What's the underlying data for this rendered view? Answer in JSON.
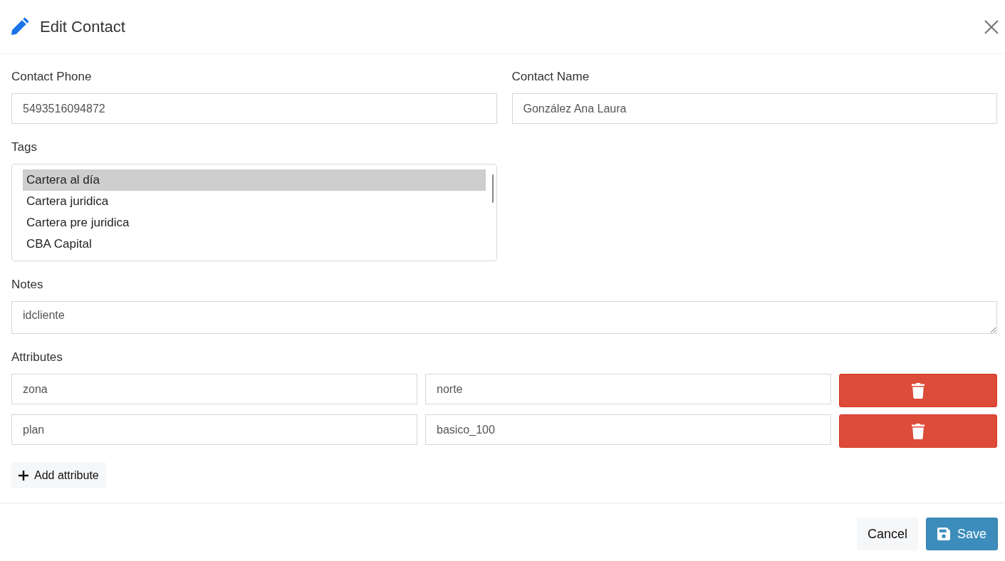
{
  "dialog": {
    "title": "Edit Contact"
  },
  "fields": [
    {
      "label": "Contact Phone",
      "value": "5493516094872"
    },
    {
      "label": "Contact Name",
      "value": "González Ana Laura"
    }
  ],
  "tags": {
    "label": "Tags",
    "options": [
      {
        "label": "Cartera al día",
        "selected": true
      },
      {
        "label": "Cartera juridica",
        "selected": false
      },
      {
        "label": "Cartera pre juridica",
        "selected": false
      },
      {
        "label": "CBA Capital",
        "selected": false
      }
    ]
  },
  "notes": {
    "label": "Notes",
    "value": "idcliente"
  },
  "attributes": {
    "label": "Attributes",
    "rows": [
      {
        "key": "zona",
        "value": "norte"
      },
      {
        "key": "plan",
        "value": "basico_100"
      }
    ],
    "add_button": "Add attribute"
  },
  "footer": {
    "buttons": [
      {
        "label": "Cancel",
        "kind": "secondary"
      },
      {
        "label": "Save",
        "kind": "primary"
      }
    ]
  }
}
